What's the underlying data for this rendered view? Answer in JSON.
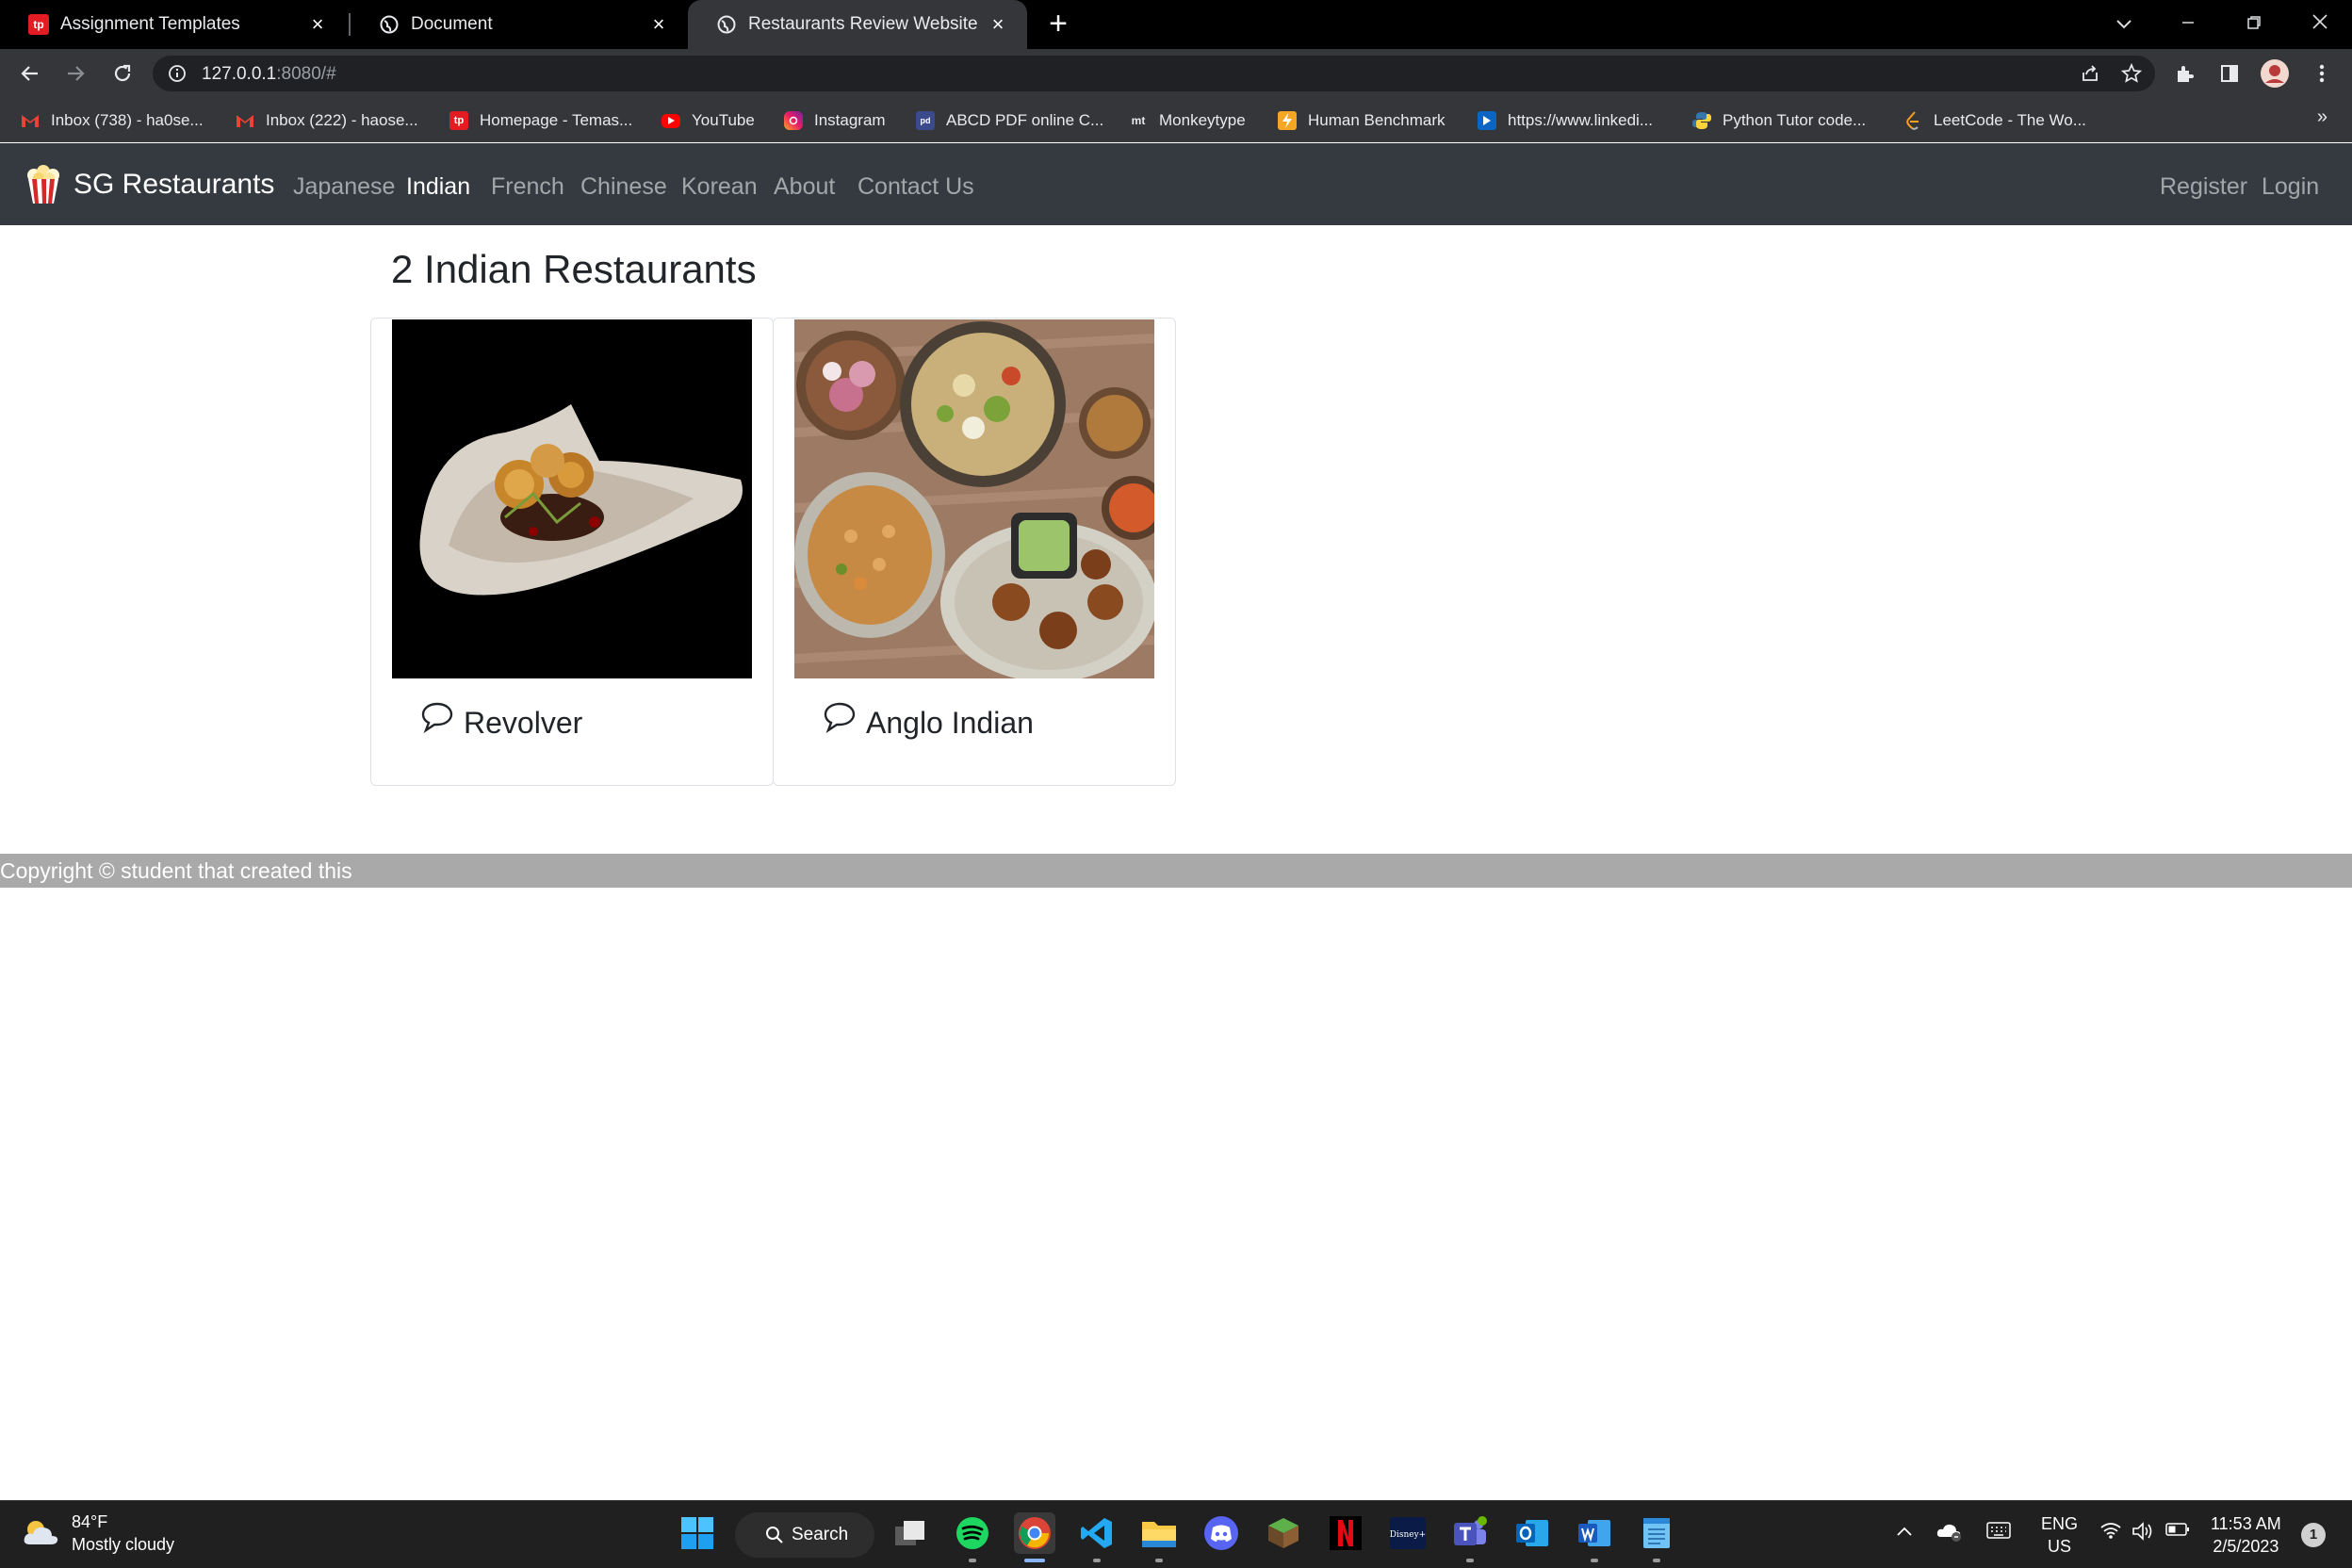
{
  "browser": {
    "tabs": [
      {
        "title": "Assignment Templates",
        "active": false
      },
      {
        "title": "Document",
        "active": false
      },
      {
        "title": "Restaurants Review Website",
        "active": true
      }
    ],
    "url_host": "127.0.0.1",
    "url_path": ":8080/#",
    "bookmarks": [
      {
        "label": "Inbox (738) - ha0se...",
        "icon": "gmail-icon"
      },
      {
        "label": "Inbox (222) - haose...",
        "icon": "gmail-icon"
      },
      {
        "label": "Homepage - Temas...",
        "icon": "tp-icon"
      },
      {
        "label": "YouTube",
        "icon": "youtube-icon"
      },
      {
        "label": "Instagram",
        "icon": "instagram-icon"
      },
      {
        "label": "ABCD PDF online C...",
        "icon": "pdf-icon"
      },
      {
        "label": "Monkeytype",
        "icon": "monkeytype-icon"
      },
      {
        "label": "Human Benchmark",
        "icon": "lightning-icon"
      },
      {
        "label": "https://www.linkedi...",
        "icon": "linkedin-icon"
      },
      {
        "label": "Python Tutor code...",
        "icon": "python-icon"
      },
      {
        "label": "LeetCode - The Wo...",
        "icon": "leetcode-icon"
      }
    ],
    "bookmarks_more": "»"
  },
  "site": {
    "brand": "SG Restaurants",
    "nav": [
      {
        "label": "Japanese",
        "active": false
      },
      {
        "label": "Indian",
        "active": true
      },
      {
        "label": "French",
        "active": false
      },
      {
        "label": "Chinese",
        "active": false
      },
      {
        "label": "Korean",
        "active": false
      },
      {
        "label": "About",
        "active": false
      },
      {
        "label": "Contact Us",
        "active": false
      }
    ],
    "auth": {
      "register": "Register",
      "login": "Login"
    },
    "heading": "2 Indian Restaurants",
    "restaurants": [
      {
        "name": "Revolver"
      },
      {
        "name": "Anglo Indian"
      }
    ],
    "footer": "Copyright © student that created this"
  },
  "taskbar": {
    "weather_temp": "84°F",
    "weather_desc": "Mostly cloudy",
    "search_label": "Search",
    "lang_top": "ENG",
    "lang_bottom": "US",
    "time": "11:53 AM",
    "date": "2/5/2023",
    "notification_count": "1"
  },
  "colors": {
    "navbar_bg": "#343a40",
    "footer_bg": "#a9a9a9",
    "chrome_bg": "#35363a"
  }
}
